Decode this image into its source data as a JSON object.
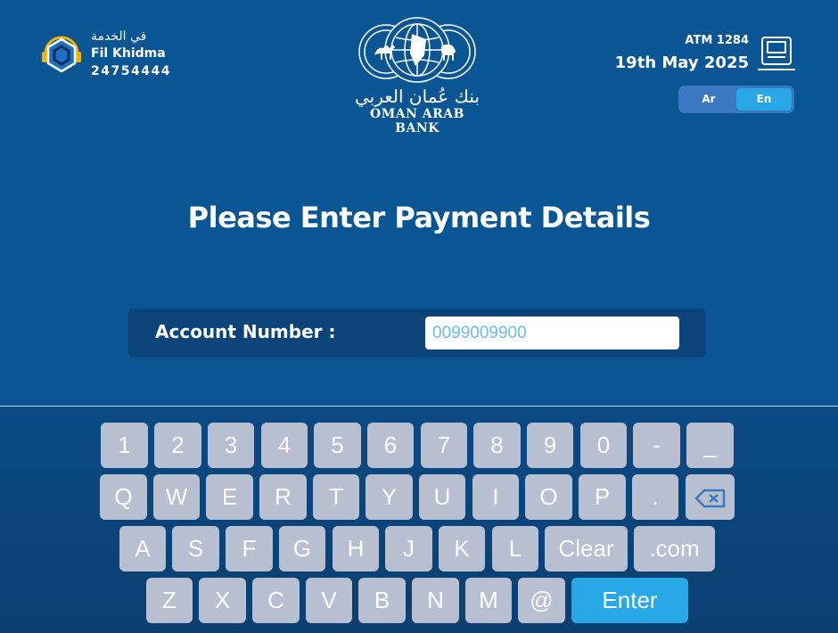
{
  "header": {
    "fil_khidma": {
      "arabic": "في الخدمة",
      "name": "Fil Khidma",
      "phone": "24754444"
    },
    "logo": {
      "arabic": "بنك عُمان العربي",
      "english": "OMAN ARAB BANK"
    },
    "atm_id": "ATM 1284",
    "date": "19th May 2025",
    "languages": [
      "Ar",
      "En"
    ],
    "selected_language": "En"
  },
  "main": {
    "title": "Please Enter Payment Details",
    "account_label": "Account Number :",
    "account_placeholder": "0099009900"
  },
  "keyboard": {
    "rows": [
      [
        "1",
        "2",
        "3",
        "4",
        "5",
        "6",
        "7",
        "8",
        "9",
        "0",
        "-",
        "_"
      ],
      [
        "Q",
        "W",
        "E",
        "R",
        "T",
        "Y",
        "U",
        "I",
        "O",
        "P",
        ".",
        "backspace-icon"
      ],
      [
        "A",
        "S",
        "F",
        "G",
        "H",
        "J",
        "K",
        "L",
        "Clear",
        ".com"
      ],
      [
        "Z",
        "X",
        "C",
        "V",
        "B",
        "N",
        "M",
        "@",
        "Enter"
      ]
    ]
  },
  "colors": {
    "background": "#0a5594",
    "panel": "#0b4478",
    "key": "#b8bfd0",
    "accent": "#29a8e8"
  }
}
